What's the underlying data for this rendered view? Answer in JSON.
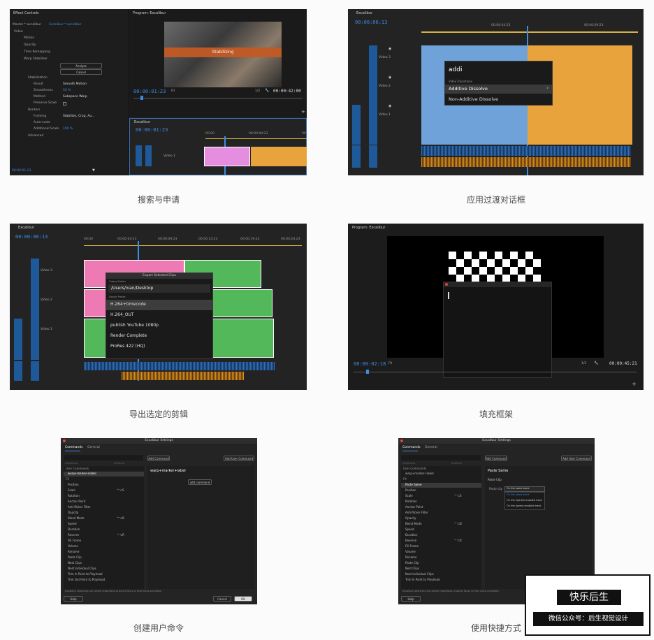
{
  "panels": {
    "p1": {
      "effect_controls_title": "Effect Controls",
      "source_line": "Master * excalibur",
      "source_active": "Excalibur * excalibur",
      "video_label": "Video",
      "fx_motion": "Motion",
      "fx_opacity": "Opacity",
      "fx_time_remap": "Time Remapping",
      "fx_warp": "Warp Stabilizer",
      "analyze_btn": "Analyze",
      "cancel_btn": "Cancel",
      "stabilization": "Stabilization",
      "result_label": "Result",
      "result_val": "Smooth Motion",
      "smoothness_label": "Smoothness",
      "smoothness_val": "50 %",
      "method_label": "Method",
      "method_val": "Subspace Warp",
      "preserve_label": "Preserve Scale",
      "borders_label": "Borders",
      "framing_label": "Framing",
      "framing_val": "Stabilize, Crop, Au...",
      "autoscale_label": "Auto-scale",
      "add_scaling_label": "Additional Scale",
      "add_scaling_val": "100 %",
      "advanced_label": "Advanced",
      "ec_timecode": "00:00:01:23",
      "program_title": "Program: Excalibur",
      "stabilizing": "Stabilizing",
      "prog_tc": "00:00:01:23",
      "fit": "Fit",
      "fraction": "1/2",
      "prog_dur": "00:00:42:00",
      "seq_tab": "Excalibur",
      "seq_tc": "00:00:01:23",
      "r0": "00:00",
      "r1": "00:00:04:23",
      "r2": "00",
      "v1_label": "V1",
      "video1": "Video 1"
    },
    "p2": {
      "seq_tab": "Excalibur",
      "timecode": "00:00:06:13",
      "ruler_1": "00:00:04:23",
      "ruler_2": "00:00:09:23",
      "search_text": "addi",
      "section": "Video Transitions",
      "item_1": "Additive Dissolve",
      "item_2": "Non-Additive Dissolve",
      "video1": "Video 1",
      "video2": "Video 2",
      "video3": "Video 3"
    },
    "p3": {
      "seq_tab": "Excalibur",
      "timecode": "00:00:06:13",
      "r0": "00:00",
      "r1": "00:00:04:23",
      "r2": "00:00:09:23",
      "r3": "00:00:14:23",
      "r4": "00:00:19:23",
      "r5": "00:00:24:23",
      "video1": "Video 1",
      "video2": "Video 2",
      "video3": "Video 3",
      "dialog_title": "Export Selected Clips",
      "output_folder_label": "Output Folder",
      "output_folder": "/Users/ivan/Desktop",
      "preset_label": "Export Preset",
      "presets": [
        "H.264+timecode",
        "H.264_OUT",
        "publish YouTube 1080p",
        "Render Complete",
        "ProRes 422 (HQ)"
      ]
    },
    "p4": {
      "program_title": "Program: Excalibur",
      "tc": "00:00:02:18",
      "fit": "Fit",
      "fraction": "1/2",
      "dur": "00:00:45:21"
    },
    "p5": {
      "title": "Excalibur Settings",
      "tab_commands": "Commands",
      "tab_general": "General",
      "add_command": "Add Command",
      "add_user_command": "Add User Command",
      "col_name": "Command",
      "col_shortcut": "Shortcut",
      "group_user": "User Commands",
      "selected": "warp+marker+label",
      "group_fx": "FX",
      "items": [
        "Position",
        "Scale",
        "Rotation",
        "Anchor Point",
        "Anti-flicker Filter",
        "Opacity",
        "Blend Mode",
        "Speed",
        "Duration",
        "Reverse",
        "Fill Frame",
        "Volume",
        "Rename",
        "Paste Clip",
        "Nest Clips",
        "Nest Individual Clips",
        "Trim In Point to Playhead",
        "Trim Out Point to Playhead"
      ],
      "shortcut_scale": "^⌥S",
      "shortcut_blend": "^⌥B",
      "shortcut_reverse": "^⌥R",
      "detail_title": "warp+marker+label",
      "add_command_inner": "add command",
      "footer": "Excalibur shortcuts are active regardless of panel focus or text input activated.",
      "help": "Help",
      "cancel": "Cancel",
      "ok": "OK"
    },
    "p6": {
      "title": "Excalibur Settings",
      "tab_commands": "Commands",
      "tab_general": "General",
      "add_command": "Add Command",
      "add_user_command": "Add User Command",
      "col_name": "Command",
      "col_shortcut": "Shortcut",
      "group_user": "User Commands",
      "user_item": "warp+marker+label",
      "selected": "Paste Same",
      "group_fx": "FX",
      "items": [
        "Position",
        "Scale",
        "Rotation",
        "Anchor Point",
        "Anti-flicker Filter",
        "Opacity",
        "Blend Mode",
        "Speed",
        "Duration",
        "Reverse",
        "Fill Frame",
        "Volume",
        "Rename",
        "Paste Clip",
        "Nest Clips",
        "Nest Individual Clips",
        "Trim In Point to Playhead"
      ],
      "shortcut_scale": "^⌥S",
      "shortcut_blend": "^⌥B",
      "shortcut_reverse": "^⌥R",
      "detail_title": "Paste Same",
      "detail_sub": "Paste Clip",
      "paste_clip_label": "Paste clip",
      "dropdown_val": "On the same track",
      "opt_1": "On the same track",
      "opt_2": "On the highest enabled track",
      "opt_3": "On the lowest enabled track",
      "footer": "Excalibur shortcuts are active regardless of panel focus or text input activated.",
      "help": "Help",
      "cancel": "Cancel",
      "ok": "OK"
    }
  },
  "captions": {
    "c1": "搜索与申请",
    "c2": "应用过渡对话框",
    "c3": "导出选定的剪辑",
    "c4": "填充框架",
    "c5": "创建用户命令",
    "c6": "使用快捷方式"
  },
  "watermark": {
    "line1": "快乐后生",
    "line2": "微信公众号：后生视觉设计"
  }
}
